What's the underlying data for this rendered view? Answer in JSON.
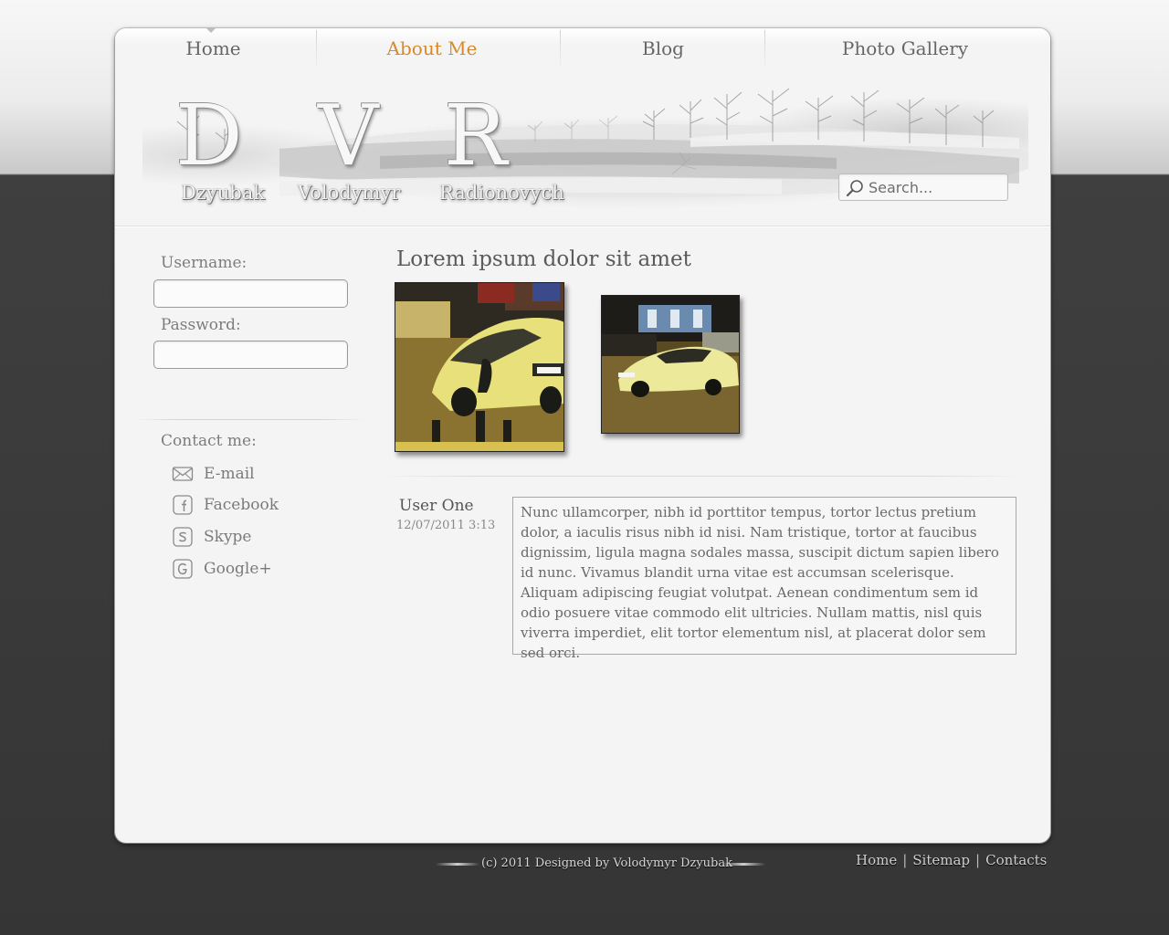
{
  "nav": {
    "items": [
      {
        "label": "Home"
      },
      {
        "label": "About Me"
      },
      {
        "label": "Blog"
      },
      {
        "label": "Photo Gallery"
      }
    ]
  },
  "header": {
    "logo_letters": [
      "D",
      "V",
      "R"
    ],
    "logo_names": [
      "Dzyubak",
      "Volodymyr",
      "Radionovych"
    ],
    "search_placeholder": "Search..."
  },
  "sidebar": {
    "username_label": "Username:",
    "password_label": "Password:",
    "contact_heading": "Contact me:",
    "contacts": [
      {
        "label": "E-mail",
        "icon": "mail-icon"
      },
      {
        "label": "Facebook",
        "icon": "facebook-icon"
      },
      {
        "label": "Skype",
        "icon": "skype-icon"
      },
      {
        "label": "Google+",
        "icon": "google-plus-icon"
      }
    ]
  },
  "post": {
    "title": "Lorem ipsum dolor sit amet",
    "photos": [
      "yellow-sports-car-photo",
      "yellow-sports-car-photo"
    ]
  },
  "comment": {
    "author": "User One",
    "date": "12/07/2011  3:13",
    "text": "Nunc ullamcorper, nibh id porttitor tempus, tortor lectus pretium dolor, a iaculis risus nibh id nisi. Nam tristique, tortor at faucibus dignissim, ligula magna sodales massa, suscipit dictum sapien libero id nunc. Viva­mus blandit urna vitae est accumsan scelerisque. Aliquam adipiscing feugiat volutpat. Aenean condimentum sem id odio posuere vitae com­modo elit ultricies. Nullam mattis, nisl quis viverra imperdiet, elit tortor elementum nisl, at placerat dolor sem sed orci."
  },
  "footer": {
    "copyright": "(c) 2011 Designed by Volodymyr Dzyubak",
    "links": [
      "Home",
      "Sitemap",
      "Contacts"
    ],
    "separator": "|"
  },
  "colors": {
    "accent": "#d8892a",
    "page_dark": "#353535",
    "card": "#f4f4f4"
  }
}
